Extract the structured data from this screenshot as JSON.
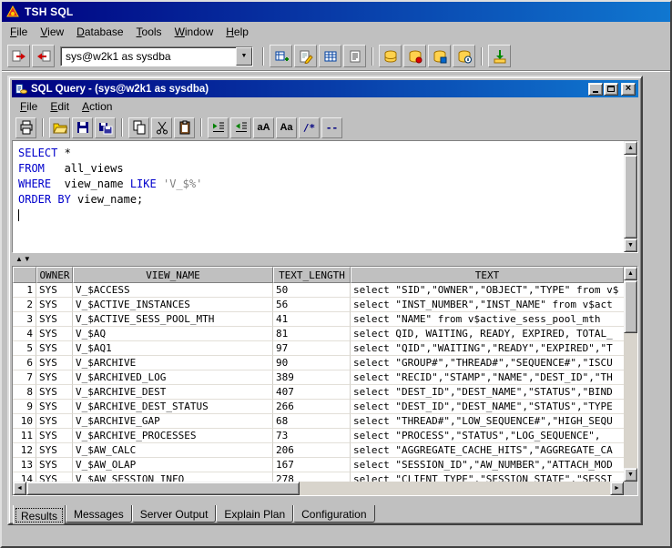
{
  "app": {
    "title": "TSH SQL",
    "menu": [
      "File",
      "View",
      "Database",
      "Tools",
      "Window",
      "Help"
    ],
    "connection": "sys@w2k1 as sysdba",
    "toolbar": [
      {
        "icon": "connect"
      },
      {
        "icon": "disconnect"
      },
      {
        "combo": true
      },
      {
        "sep": true
      },
      {
        "icon": "new-query"
      },
      {
        "icon": "edit-query"
      },
      {
        "icon": "table-data"
      },
      {
        "icon": "script"
      },
      {
        "sep": true
      },
      {
        "icon": "db-objects"
      },
      {
        "icon": "db-storage"
      },
      {
        "icon": "db-security"
      },
      {
        "icon": "db-info"
      },
      {
        "sep": true
      },
      {
        "icon": "import"
      }
    ]
  },
  "sql_window": {
    "title": "SQL Query - (sys@w2k1 as sysdba)",
    "menu": [
      "File",
      "Edit",
      "Action"
    ],
    "toolbar": [
      {
        "icon": "print"
      },
      {
        "sep": true
      },
      {
        "icon": "open"
      },
      {
        "icon": "save"
      },
      {
        "icon": "save-all"
      },
      {
        "sep": true
      },
      {
        "icon": "copy"
      },
      {
        "icon": "cut"
      },
      {
        "icon": "paste"
      },
      {
        "sep": true
      },
      {
        "icon": "indent"
      },
      {
        "icon": "outdent"
      },
      {
        "icon": "uppercase",
        "text": "aA"
      },
      {
        "icon": "capitalize",
        "text": "Aa"
      },
      {
        "icon": "block-comment",
        "text": "/*"
      },
      {
        "icon": "line-comment",
        "text": "--"
      }
    ],
    "editor_lines": [
      [
        {
          "t": "SELECT",
          "k": "kw"
        },
        {
          "t": " *",
          "k": "pl"
        }
      ],
      [
        {
          "t": "FROM",
          "k": "kw"
        },
        {
          "t": "   all_views",
          "k": "pl"
        }
      ],
      [
        {
          "t": "WHERE",
          "k": "kw"
        },
        {
          "t": "  view_name ",
          "k": "pl"
        },
        {
          "t": "LIKE",
          "k": "kw"
        },
        {
          "t": " ",
          "k": "pl"
        },
        {
          "t": "'V_$%'",
          "k": "st"
        }
      ],
      [
        {
          "t": "ORDER BY",
          "k": "kw"
        },
        {
          "t": " view_name;",
          "k": "pl"
        }
      ]
    ]
  },
  "results": {
    "columns": [
      "OWNER",
      "VIEW_NAME",
      "TEXT_LENGTH",
      "TEXT"
    ],
    "rows": [
      {
        "num": "1",
        "owner": "SYS",
        "view": "V_$ACCESS",
        "len": "50",
        "text": "select \"SID\",\"OWNER\",\"OBJECT\",\"TYPE\" from v$"
      },
      {
        "num": "2",
        "owner": "SYS",
        "view": "V_$ACTIVE_INSTANCES",
        "len": "56",
        "text": "select \"INST_NUMBER\",\"INST_NAME\" from v$act"
      },
      {
        "num": "3",
        "owner": "SYS",
        "view": "V_$ACTIVE_SESS_POOL_MTH",
        "len": "41",
        "text": "select \"NAME\" from v$active_sess_pool_mth"
      },
      {
        "num": "4",
        "owner": "SYS",
        "view": "V_$AQ",
        "len": "81",
        "text": "select QID, WAITING, READY, EXPIRED, TOTAL_"
      },
      {
        "num": "5",
        "owner": "SYS",
        "view": "V_$AQ1",
        "len": "97",
        "text": "select \"QID\",\"WAITING\",\"READY\",\"EXPIRED\",\"T"
      },
      {
        "num": "6",
        "owner": "SYS",
        "view": "V_$ARCHIVE",
        "len": "90",
        "text": "select \"GROUP#\",\"THREAD#\",\"SEQUENCE#\",\"ISCU"
      },
      {
        "num": "7",
        "owner": "SYS",
        "view": "V_$ARCHIVED_LOG",
        "len": "389",
        "text": "select \"RECID\",\"STAMP\",\"NAME\",\"DEST_ID\",\"TH"
      },
      {
        "num": "8",
        "owner": "SYS",
        "view": "V_$ARCHIVE_DEST",
        "len": "407",
        "text": "select \"DEST_ID\",\"DEST_NAME\",\"STATUS\",\"BIND"
      },
      {
        "num": "9",
        "owner": "SYS",
        "view": "V_$ARCHIVE_DEST_STATUS",
        "len": "266",
        "text": "select \"DEST_ID\",\"DEST_NAME\",\"STATUS\",\"TYPE"
      },
      {
        "num": "10",
        "owner": "SYS",
        "view": "V_$ARCHIVE_GAP",
        "len": "68",
        "text": "select \"THREAD#\",\"LOW_SEQUENCE#\",\"HIGH_SEQU"
      },
      {
        "num": "11",
        "owner": "SYS",
        "view": "V_$ARCHIVE_PROCESSES",
        "len": "73",
        "text": "select \"PROCESS\",\"STATUS\",\"LOG_SEQUENCE\","
      },
      {
        "num": "12",
        "owner": "SYS",
        "view": "V_$AW_CALC",
        "len": "206",
        "text": "select \"AGGREGATE_CACHE_HITS\",\"AGGREGATE_CA"
      },
      {
        "num": "13",
        "owner": "SYS",
        "view": "V_$AW_OLAP",
        "len": "167",
        "text": "select \"SESSION_ID\",\"AW_NUMBER\",\"ATTACH_MOD"
      },
      {
        "num": "14",
        "owner": "SYS",
        "view": "V_$AW_SESSION_INFO",
        "len": "278",
        "text": "select \"CLIENT_TYPE\",\"SESSION_STATE\",\"SESSI"
      }
    ]
  },
  "tabs": [
    {
      "label": "Results",
      "active": true
    },
    {
      "label": "Messages",
      "active": false
    },
    {
      "label": "Server Output",
      "active": false
    },
    {
      "label": "Explain Plan",
      "active": false
    },
    {
      "label": "Configuration",
      "active": false
    }
  ],
  "colors": {
    "titlebar_start": "#000080",
    "titlebar_end": "#1077d0",
    "keyword": "#0000cc",
    "string_literal": "#808080",
    "chrome": "#c0c0c0"
  }
}
